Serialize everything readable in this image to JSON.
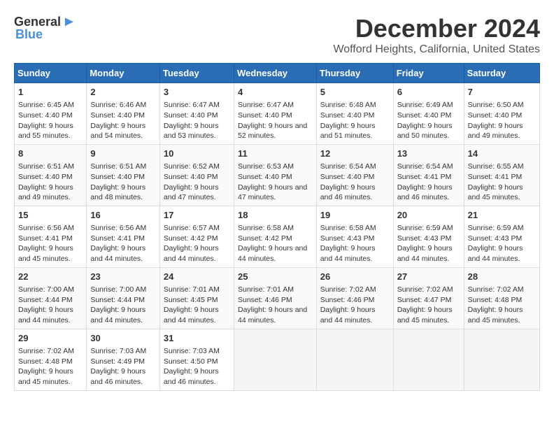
{
  "logo": {
    "text_general": "General",
    "text_blue": "Blue"
  },
  "title": {
    "month": "December 2024",
    "location": "Wofford Heights, California, United States"
  },
  "headers": [
    "Sunday",
    "Monday",
    "Tuesday",
    "Wednesday",
    "Thursday",
    "Friday",
    "Saturday"
  ],
  "weeks": [
    [
      {
        "day": "1",
        "sunrise": "Sunrise: 6:45 AM",
        "sunset": "Sunset: 4:40 PM",
        "daylight": "Daylight: 9 hours and 55 minutes."
      },
      {
        "day": "2",
        "sunrise": "Sunrise: 6:46 AM",
        "sunset": "Sunset: 4:40 PM",
        "daylight": "Daylight: 9 hours and 54 minutes."
      },
      {
        "day": "3",
        "sunrise": "Sunrise: 6:47 AM",
        "sunset": "Sunset: 4:40 PM",
        "daylight": "Daylight: 9 hours and 53 minutes."
      },
      {
        "day": "4",
        "sunrise": "Sunrise: 6:47 AM",
        "sunset": "Sunset: 4:40 PM",
        "daylight": "Daylight: 9 hours and 52 minutes."
      },
      {
        "day": "5",
        "sunrise": "Sunrise: 6:48 AM",
        "sunset": "Sunset: 4:40 PM",
        "daylight": "Daylight: 9 hours and 51 minutes."
      },
      {
        "day": "6",
        "sunrise": "Sunrise: 6:49 AM",
        "sunset": "Sunset: 4:40 PM",
        "daylight": "Daylight: 9 hours and 50 minutes."
      },
      {
        "day": "7",
        "sunrise": "Sunrise: 6:50 AM",
        "sunset": "Sunset: 4:40 PM",
        "daylight": "Daylight: 9 hours and 49 minutes."
      }
    ],
    [
      {
        "day": "8",
        "sunrise": "Sunrise: 6:51 AM",
        "sunset": "Sunset: 4:40 PM",
        "daylight": "Daylight: 9 hours and 49 minutes."
      },
      {
        "day": "9",
        "sunrise": "Sunrise: 6:51 AM",
        "sunset": "Sunset: 4:40 PM",
        "daylight": "Daylight: 9 hours and 48 minutes."
      },
      {
        "day": "10",
        "sunrise": "Sunrise: 6:52 AM",
        "sunset": "Sunset: 4:40 PM",
        "daylight": "Daylight: 9 hours and 47 minutes."
      },
      {
        "day": "11",
        "sunrise": "Sunrise: 6:53 AM",
        "sunset": "Sunset: 4:40 PM",
        "daylight": "Daylight: 9 hours and 47 minutes."
      },
      {
        "day": "12",
        "sunrise": "Sunrise: 6:54 AM",
        "sunset": "Sunset: 4:40 PM",
        "daylight": "Daylight: 9 hours and 46 minutes."
      },
      {
        "day": "13",
        "sunrise": "Sunrise: 6:54 AM",
        "sunset": "Sunset: 4:41 PM",
        "daylight": "Daylight: 9 hours and 46 minutes."
      },
      {
        "day": "14",
        "sunrise": "Sunrise: 6:55 AM",
        "sunset": "Sunset: 4:41 PM",
        "daylight": "Daylight: 9 hours and 45 minutes."
      }
    ],
    [
      {
        "day": "15",
        "sunrise": "Sunrise: 6:56 AM",
        "sunset": "Sunset: 4:41 PM",
        "daylight": "Daylight: 9 hours and 45 minutes."
      },
      {
        "day": "16",
        "sunrise": "Sunrise: 6:56 AM",
        "sunset": "Sunset: 4:41 PM",
        "daylight": "Daylight: 9 hours and 44 minutes."
      },
      {
        "day": "17",
        "sunrise": "Sunrise: 6:57 AM",
        "sunset": "Sunset: 4:42 PM",
        "daylight": "Daylight: 9 hours and 44 minutes."
      },
      {
        "day": "18",
        "sunrise": "Sunrise: 6:58 AM",
        "sunset": "Sunset: 4:42 PM",
        "daylight": "Daylight: 9 hours and 44 minutes."
      },
      {
        "day": "19",
        "sunrise": "Sunrise: 6:58 AM",
        "sunset": "Sunset: 4:43 PM",
        "daylight": "Daylight: 9 hours and 44 minutes."
      },
      {
        "day": "20",
        "sunrise": "Sunrise: 6:59 AM",
        "sunset": "Sunset: 4:43 PM",
        "daylight": "Daylight: 9 hours and 44 minutes."
      },
      {
        "day": "21",
        "sunrise": "Sunrise: 6:59 AM",
        "sunset": "Sunset: 4:43 PM",
        "daylight": "Daylight: 9 hours and 44 minutes."
      }
    ],
    [
      {
        "day": "22",
        "sunrise": "Sunrise: 7:00 AM",
        "sunset": "Sunset: 4:44 PM",
        "daylight": "Daylight: 9 hours and 44 minutes."
      },
      {
        "day": "23",
        "sunrise": "Sunrise: 7:00 AM",
        "sunset": "Sunset: 4:44 PM",
        "daylight": "Daylight: 9 hours and 44 minutes."
      },
      {
        "day": "24",
        "sunrise": "Sunrise: 7:01 AM",
        "sunset": "Sunset: 4:45 PM",
        "daylight": "Daylight: 9 hours and 44 minutes."
      },
      {
        "day": "25",
        "sunrise": "Sunrise: 7:01 AM",
        "sunset": "Sunset: 4:46 PM",
        "daylight": "Daylight: 9 hours and 44 minutes."
      },
      {
        "day": "26",
        "sunrise": "Sunrise: 7:02 AM",
        "sunset": "Sunset: 4:46 PM",
        "daylight": "Daylight: 9 hours and 44 minutes."
      },
      {
        "day": "27",
        "sunrise": "Sunrise: 7:02 AM",
        "sunset": "Sunset: 4:47 PM",
        "daylight": "Daylight: 9 hours and 45 minutes."
      },
      {
        "day": "28",
        "sunrise": "Sunrise: 7:02 AM",
        "sunset": "Sunset: 4:48 PM",
        "daylight": "Daylight: 9 hours and 45 minutes."
      }
    ],
    [
      {
        "day": "29",
        "sunrise": "Sunrise: 7:02 AM",
        "sunset": "Sunset: 4:48 PM",
        "daylight": "Daylight: 9 hours and 45 minutes."
      },
      {
        "day": "30",
        "sunrise": "Sunrise: 7:03 AM",
        "sunset": "Sunset: 4:49 PM",
        "daylight": "Daylight: 9 hours and 46 minutes."
      },
      {
        "day": "31",
        "sunrise": "Sunrise: 7:03 AM",
        "sunset": "Sunset: 4:50 PM",
        "daylight": "Daylight: 9 hours and 46 minutes."
      },
      null,
      null,
      null,
      null
    ]
  ]
}
